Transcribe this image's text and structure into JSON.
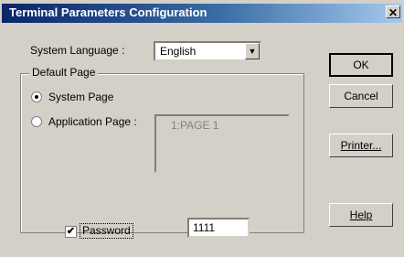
{
  "window": {
    "title": "Terminal Parameters Configuration",
    "close_label": "✕"
  },
  "language": {
    "label": "System Language :",
    "value": "English",
    "arrow": "▼"
  },
  "default_page": {
    "group_label": "Default Page",
    "system_page_label": "System Page",
    "application_page_label": "Application Page :",
    "selected": "System Page",
    "pages": [
      "1:PAGE 1"
    ]
  },
  "password": {
    "label": "Password",
    "checked": true,
    "check_mark": "✔",
    "value": "1111"
  },
  "buttons": {
    "ok": "OK",
    "cancel": "Cancel",
    "printer": "Printer...",
    "help": "Help"
  }
}
